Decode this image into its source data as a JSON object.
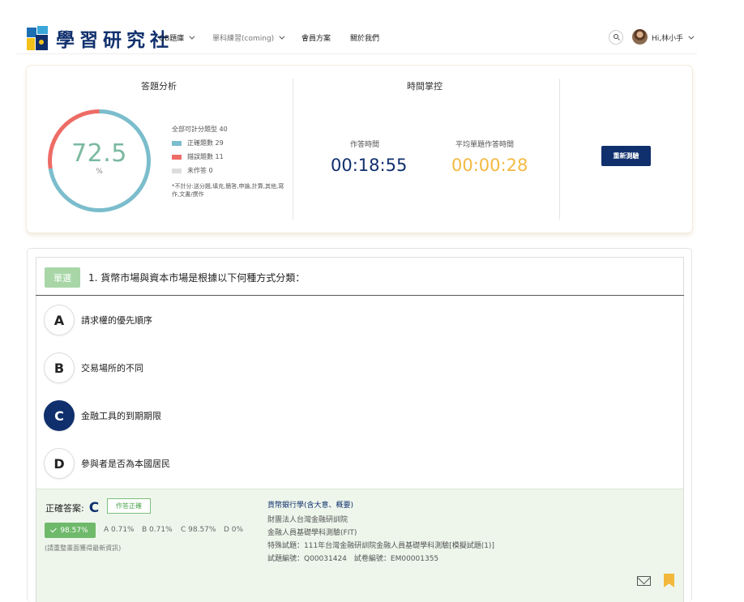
{
  "header": {
    "logo_text": "學習研究社",
    "nav": [
      {
        "label": "QB題庫"
      },
      {
        "label": "單科練習(coming)"
      },
      {
        "label": "會員方案"
      },
      {
        "label": "關於我們"
      }
    ],
    "user_greeting": "Hi,林小手"
  },
  "analysis": {
    "title": "答題分析",
    "score": "72.5",
    "unit": "%",
    "total": "全部可計分題型 40",
    "legend": [
      {
        "label": "正確題數 29",
        "color": "#7bbdcc"
      },
      {
        "label": "錯誤題數 11",
        "color": "#ee6c66"
      },
      {
        "label": "未作答 0",
        "color": "#dddddd"
      }
    ],
    "note": "*不計分:送分題,填充,簡答,申論,計算,其他,寫作,文書/撰作",
    "correct_fraction": 0.725,
    "wrong_fraction": 0.275
  },
  "time": {
    "title": "時間掌控",
    "answer_label": "作答時間",
    "answer_value": "00:18:55",
    "avg_label": "平均單題作答時間",
    "avg_value": "00:00:28",
    "answer_color": "#10306d",
    "avg_color": "#f4b942"
  },
  "retest_label": "重新測驗",
  "question": {
    "type": "單選",
    "text": "1. 貨幣市場與資本市場是根據以下何種方式分類：",
    "options": [
      {
        "letter": "A",
        "text": "請求權的優先順序"
      },
      {
        "letter": "B",
        "text": "交易場所的不同"
      },
      {
        "letter": "C",
        "text": "金融工具的到期期限"
      },
      {
        "letter": "D",
        "text": "參與者是否為本國居民"
      }
    ],
    "selected": "C"
  },
  "answer": {
    "label": "正確答案:",
    "letter": "C",
    "status": "作答正確",
    "rate": "98.57%",
    "stats": [
      "A 0.71%",
      "B 0.71%",
      "C 98.57%",
      "D 0%"
    ],
    "reload_note": "(請重整畫面獲得最新資訊)",
    "subject": "貨幣銀行學(含大意、概要)",
    "info_lines": [
      "財團法人台灣金融研訓院",
      "金融人員基礎學科測驗(FIT)",
      "特殊試題：111年台灣金融研訓院金融人員基礎學科測驗[模擬試題(1)]",
      "試題編號：Q00031424　試卷編號：EM00001355"
    ]
  }
}
